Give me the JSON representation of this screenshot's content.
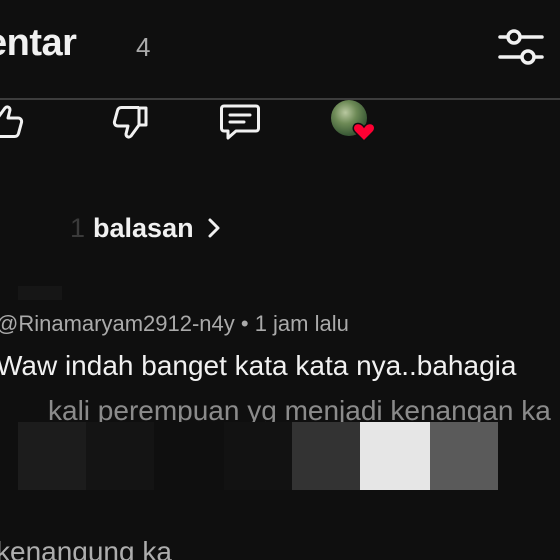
{
  "header": {
    "title": "entar",
    "count": "4",
    "filter_icon": "sliders-icon"
  },
  "actions": {
    "like_icon": "thumbs-up-icon",
    "dislike_icon": "thumbs-down-icon",
    "reply_icon": "comment-icon",
    "creator_heart_icon": "heart-icon"
  },
  "replies": {
    "count": "1",
    "label": "balasan"
  },
  "comment": {
    "meta": "@Rinamaryam2912-n4y • 1 jam lalu",
    "text_line1": "Waw indah banget kata kata nya..bahagia",
    "text_line2": "kali perempuan yg menjadi kenangan ka",
    "bottom_line": "kenangung ka"
  },
  "colors": {
    "background": "#0f0f0f",
    "text_primary": "#f1f1f1",
    "text_secondary": "#aaaaaa",
    "heart": "#ff0033",
    "divider": "#3d3d3d"
  }
}
